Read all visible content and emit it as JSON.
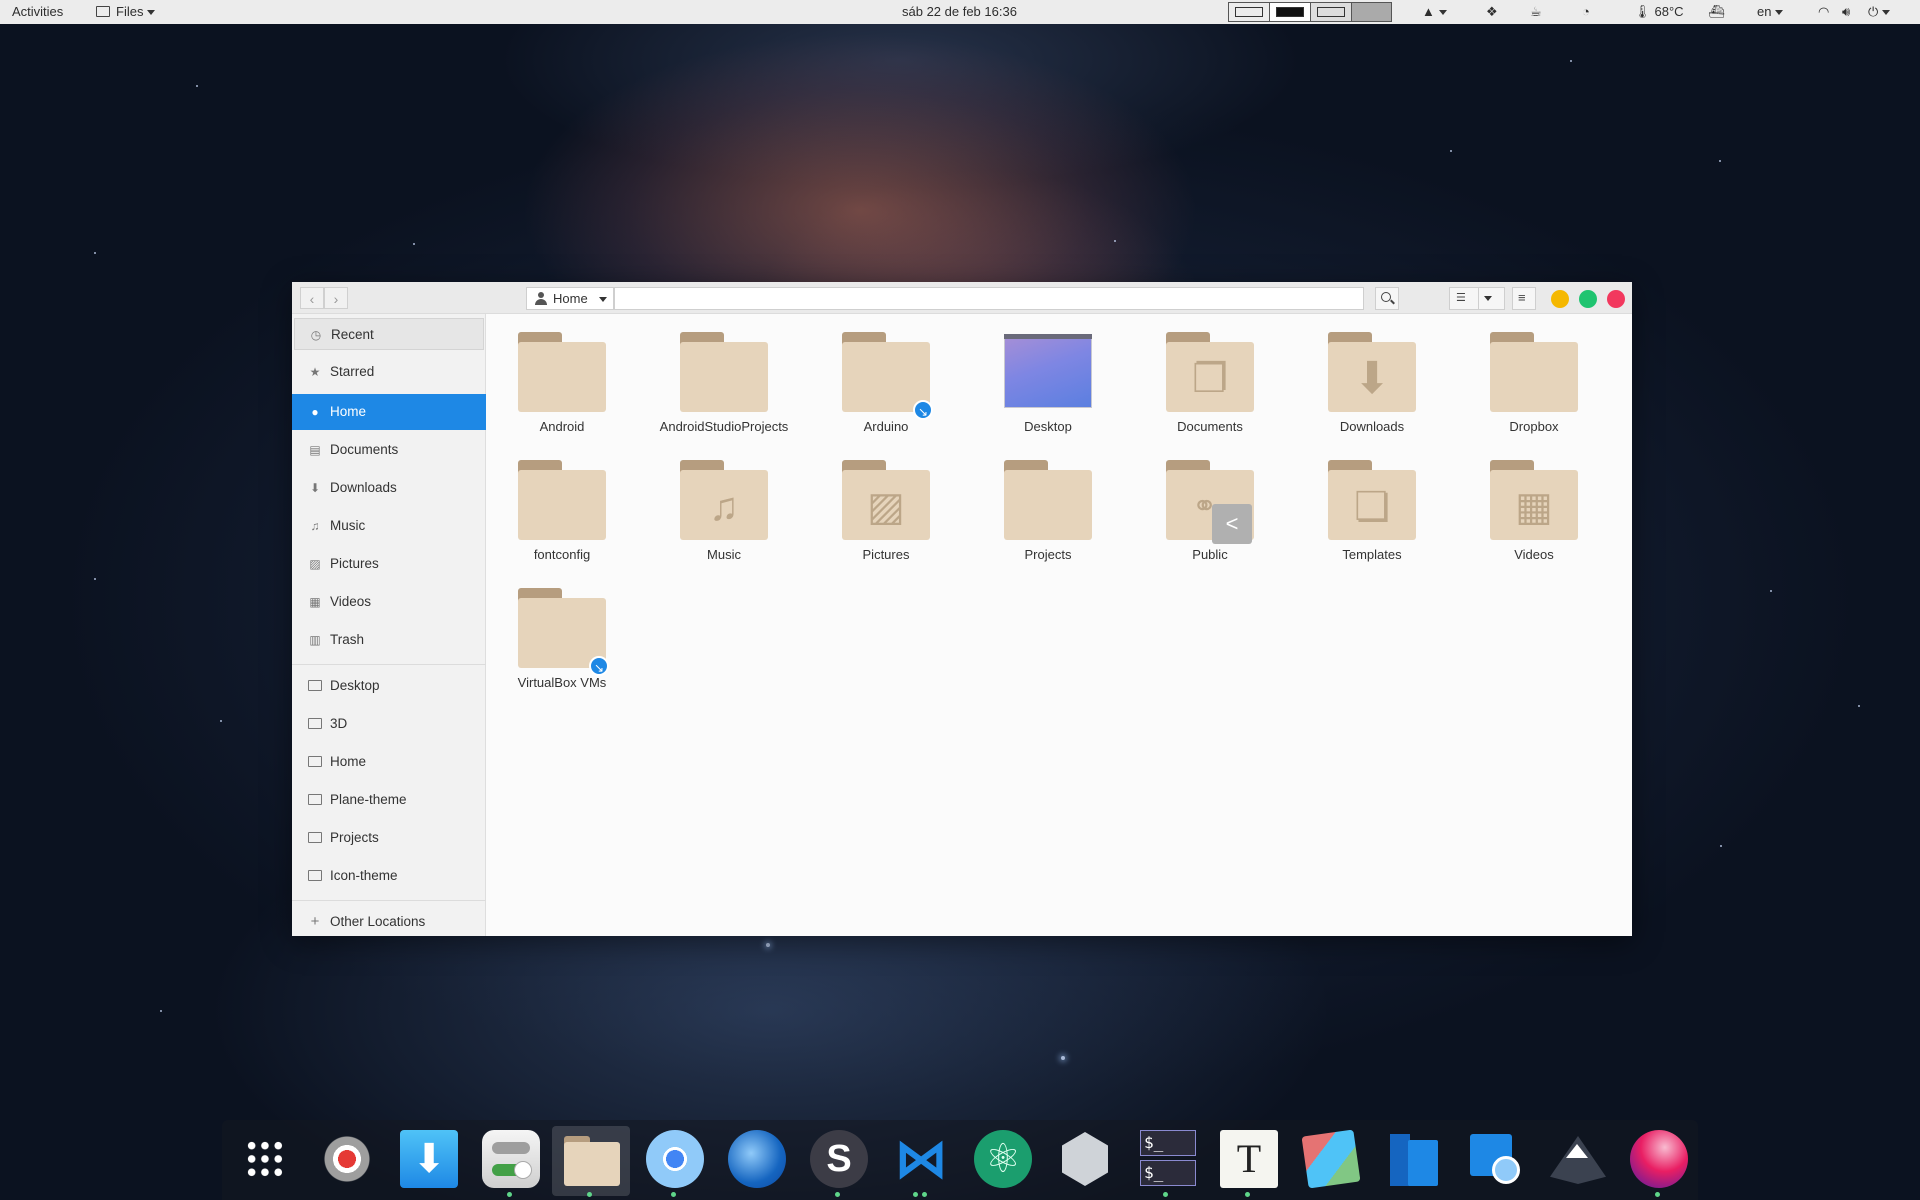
{
  "topbar": {
    "activities": "Activities",
    "app_menu": "Files",
    "clock": "sáb 22 de feb  16:36",
    "temperature": "68°C",
    "keyboard_layout": "en"
  },
  "window": {
    "path_label": "Home"
  },
  "sidebar": {
    "places": [
      {
        "label": "Recent",
        "icon": "clock-icon"
      },
      {
        "label": "Starred",
        "icon": "star-icon"
      },
      {
        "label": "Home",
        "icon": "home-icon"
      },
      {
        "label": "Documents",
        "icon": "document-icon"
      },
      {
        "label": "Downloads",
        "icon": "download-icon"
      },
      {
        "label": "Music",
        "icon": "music-icon"
      },
      {
        "label": "Pictures",
        "icon": "picture-icon"
      },
      {
        "label": "Videos",
        "icon": "video-icon"
      },
      {
        "label": "Trash",
        "icon": "trash-icon"
      }
    ],
    "bookmarks": [
      "Desktop",
      "3D",
      "Home",
      "Plane-theme",
      "Projects",
      "Icon-theme"
    ],
    "other_locations": "Other Locations"
  },
  "files": [
    {
      "name": "Android",
      "icon": "folder-icon"
    },
    {
      "name": "AndroidStudioProjects",
      "icon": "folder-icon"
    },
    {
      "name": "Arduino",
      "icon": "folder-link-icon"
    },
    {
      "name": "Desktop",
      "icon": "desktop-folder-icon"
    },
    {
      "name": "Documents",
      "icon": "folder-documents-icon"
    },
    {
      "name": "Downloads",
      "icon": "folder-downloads-icon"
    },
    {
      "name": "Dropbox",
      "icon": "folder-icon"
    },
    {
      "name": "fontconfig",
      "icon": "folder-icon"
    },
    {
      "name": "Music",
      "icon": "folder-music-icon"
    },
    {
      "name": "Pictures",
      "icon": "folder-pictures-icon"
    },
    {
      "name": "Projects",
      "icon": "folder-icon"
    },
    {
      "name": "Public",
      "icon": "folder-public-icon"
    },
    {
      "name": "Templates",
      "icon": "folder-templates-icon"
    },
    {
      "name": "Videos",
      "icon": "folder-videos-icon"
    },
    {
      "name": "VirtualBox VMs",
      "icon": "folder-link-icon"
    }
  ],
  "dock": [
    "app-grid-icon",
    "settings-icon",
    "downloader-icon",
    "tweaks-icon",
    "files-icon",
    "chromium-icon",
    "firefox-icon",
    "simplenote-icon",
    "vscode-icon",
    "atom-icon",
    "hex-editor-icon",
    "terminal-icon",
    "typora-icon",
    "gtk-icon",
    "software-icon",
    "virtual-machine-icon",
    "inkscape-icon",
    "browser-icon"
  ],
  "colors": {
    "accent": "#1e88e5",
    "folder": "#e6d4bb",
    "minimize": "#f5b800",
    "maximize": "#1fc470",
    "close": "#f2385e"
  }
}
